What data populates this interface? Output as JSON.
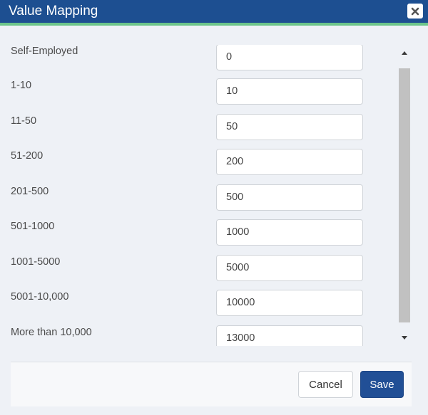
{
  "dialog": {
    "title": "Value Mapping",
    "close_icon": "close-icon",
    "accent_color": "#6cc58a",
    "header_color": "#1d4f91"
  },
  "mappings": [
    {
      "label": "Self-Employed",
      "value": "0"
    },
    {
      "label": "1-10",
      "value": "10"
    },
    {
      "label": "11-50",
      "value": "50"
    },
    {
      "label": "51-200",
      "value": "200"
    },
    {
      "label": "201-500",
      "value": "500"
    },
    {
      "label": "501-1000",
      "value": "1000"
    },
    {
      "label": "1001-5000",
      "value": "5000"
    },
    {
      "label": "5001-10,000",
      "value": "10000"
    },
    {
      "label": "More than 10,000",
      "value": "13000"
    }
  ],
  "footer": {
    "cancel_label": "Cancel",
    "save_label": "Save"
  }
}
